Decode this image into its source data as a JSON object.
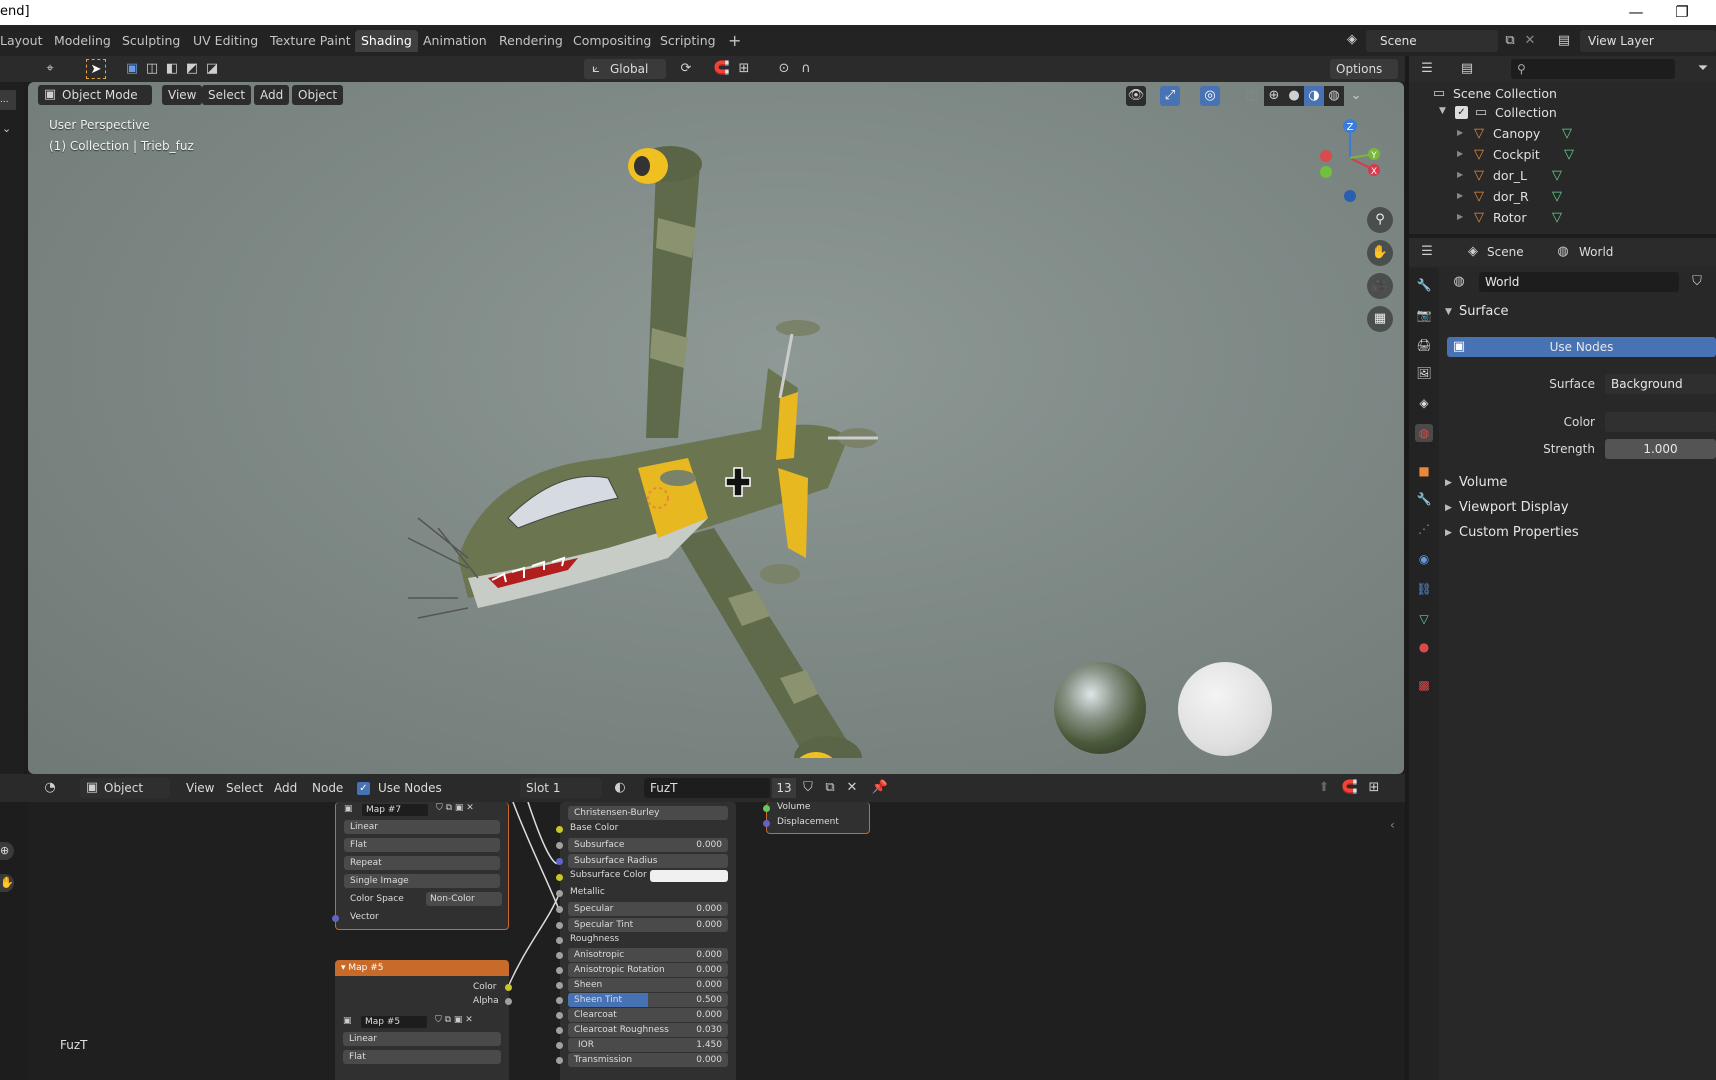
{
  "window": {
    "title": "end]",
    "minimize": "—",
    "restore": "❐"
  },
  "workspaces": [
    "Layout",
    "Modeling",
    "Sculpting",
    "UV Editing",
    "Texture Paint",
    "Shading",
    "Animation",
    "Rendering",
    "Compositing",
    "Scripting"
  ],
  "active_workspace": "Shading",
  "topright": {
    "scene": "Scene",
    "view_layer": "View Layer"
  },
  "viewport": {
    "transform_orientation": "Global",
    "options_label": "Options",
    "mode": "Object Mode",
    "menus": [
      "View",
      "Select",
      "Add",
      "Object"
    ],
    "info_line1": "User Perspective",
    "info_line2": "(1) Collection | Trieb_fuz",
    "gizmo": {
      "z": "Z",
      "y": "Y",
      "x": "X"
    }
  },
  "node_header": {
    "editor": "Object",
    "menus": [
      "View",
      "Select",
      "Add",
      "Node"
    ],
    "use_nodes": "Use Nodes",
    "slot": "Slot 1",
    "material": "FuzT",
    "users": "13"
  },
  "nodes": {
    "map7": {
      "name": "Map #7",
      "rows": [
        "Linear",
        "Flat",
        "Repeat",
        "Single Image"
      ],
      "colorspace_label": "Color Space",
      "colorspace_value": "Non-Color",
      "vector": "Vector"
    },
    "map5": {
      "title": "Map #5",
      "out_color": "Color",
      "out_alpha": "Alpha",
      "name": "Map #5",
      "rows": [
        "Linear",
        "Flat"
      ]
    },
    "bsdf": {
      "method": "Christensen-Burley",
      "base_color": "Base Color",
      "subsurface": {
        "label": "Subsurface",
        "value": "0.000"
      },
      "subsurface_radius": "Subsurface Radius",
      "subsurface_color": "Subsurface Color",
      "metallic": "Metallic",
      "specular": {
        "label": "Specular",
        "value": "0.000"
      },
      "specular_tint": {
        "label": "Specular Tint",
        "value": "0.000"
      },
      "roughness": "Roughness",
      "anisotropic": {
        "label": "Anisotropic",
        "value": "0.000"
      },
      "anisotropic_rotation": {
        "label": "Anisotropic Rotation",
        "value": "0.000"
      },
      "sheen": {
        "label": "Sheen",
        "value": "0.000"
      },
      "sheen_tint": {
        "label": "Sheen Tint",
        "value": "0.500",
        "fraction": 0.5
      },
      "clearcoat": {
        "label": "Clearcoat",
        "value": "0.000"
      },
      "clearcoat_roughness": {
        "label": "Clearcoat Roughness",
        "value": "0.030"
      },
      "ior": {
        "label": "IOR",
        "value": "1.450"
      },
      "transmission": {
        "label": "Transmission",
        "value": "0.000"
      }
    },
    "output": {
      "volume": "Volume",
      "displacement": "Displacement"
    },
    "material_label": "FuzT"
  },
  "outliner": {
    "root": "Scene Collection",
    "collection": "Collection",
    "items": [
      "Canopy",
      "Cockpit",
      "dor_L",
      "dor_R",
      "Rotor"
    ]
  },
  "properties": {
    "breadcrumb_scene": "Scene",
    "breadcrumb_world": "World",
    "world_name": "World",
    "surface_panel": "Surface",
    "use_nodes": "Use Nodes",
    "surface_label": "Surface",
    "surface_value": "Background",
    "color_label": "Color",
    "strength_label": "Strength",
    "strength_value": "1.000",
    "subpanels": [
      "Volume",
      "Viewport Display",
      "Custom Properties"
    ]
  },
  "colors": {
    "accent_blue": "#4772b3",
    "node_orange": "#c86a2a",
    "object_orange": "#e8883a",
    "mesh_green": "#63d38b"
  }
}
